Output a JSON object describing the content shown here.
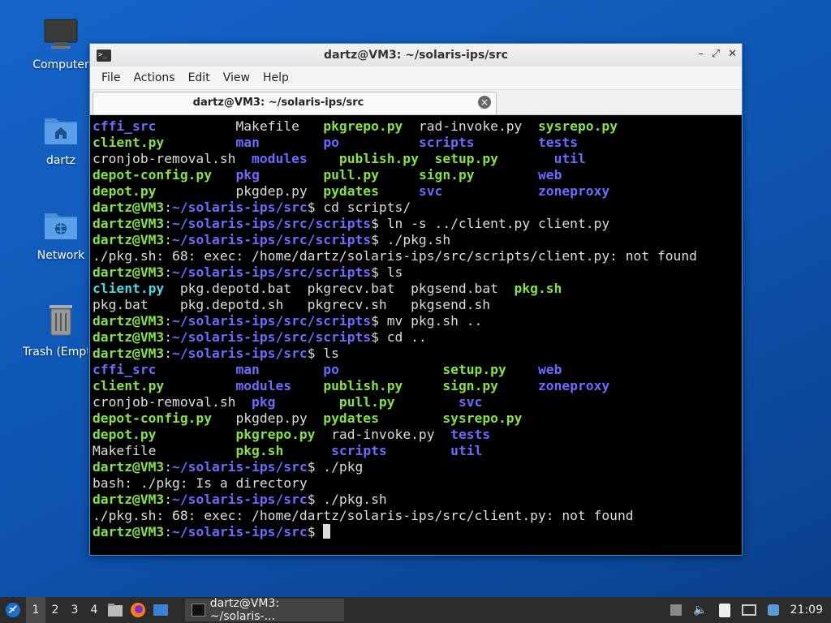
{
  "desktop": {
    "icons": [
      {
        "label": "Computer"
      },
      {
        "label": "dartz"
      },
      {
        "label": "Network"
      },
      {
        "label": "Trash (Empty)"
      }
    ]
  },
  "window": {
    "title": "dartz@VM3: ~/solaris-ips/src",
    "menu": [
      "File",
      "Actions",
      "Edit",
      "View",
      "Help"
    ],
    "tab_title": "dartz@VM3: ~/solaris-ips/src"
  },
  "terminal": {
    "colors": {
      "exec": "#86e04a",
      "dir": "#6a6bff",
      "link": "#4fd6e3",
      "text": "#dcdcdc"
    },
    "lines": [
      [
        [
          "cffi_src          ",
          "b"
        ],
        [
          "Makefile   ",
          "w"
        ],
        [
          "pkgrepo.py",
          "g"
        ],
        [
          "  ",
          "w"
        ],
        [
          "rad-invoke.py  ",
          "w"
        ],
        [
          "sysrepo.py",
          "g"
        ]
      ],
      [
        [
          "client.py",
          "g"
        ],
        [
          "         ",
          "w"
        ],
        [
          "man",
          "b"
        ],
        [
          "        ",
          "w"
        ],
        [
          "po",
          "b"
        ],
        [
          "          ",
          "w"
        ],
        [
          "scripts",
          "b"
        ],
        [
          "        ",
          "w"
        ],
        [
          "tests",
          "b"
        ]
      ],
      [
        [
          "cronjob-removal.sh  ",
          "w"
        ],
        [
          "modules",
          "b"
        ],
        [
          "    ",
          "w"
        ],
        [
          "publish.py",
          "g"
        ],
        [
          "  ",
          "w"
        ],
        [
          "setup.py",
          "g"
        ],
        [
          "       ",
          "w"
        ],
        [
          "util",
          "b"
        ]
      ],
      [
        [
          "depot-config.py",
          "g"
        ],
        [
          "   ",
          "w"
        ],
        [
          "pkg",
          "b"
        ],
        [
          "        ",
          "w"
        ],
        [
          "pull.py",
          "g"
        ],
        [
          "     ",
          "w"
        ],
        [
          "sign.py",
          "g"
        ],
        [
          "        ",
          "w"
        ],
        [
          "web",
          "b"
        ]
      ],
      [
        [
          "depot.py",
          "g"
        ],
        [
          "          ",
          "w"
        ],
        [
          "pkgdep.py  ",
          "w"
        ],
        [
          "pydates",
          "g"
        ],
        [
          "     ",
          "w"
        ],
        [
          "svc",
          "b"
        ],
        [
          "            ",
          "w"
        ],
        [
          "zoneproxy",
          "b"
        ]
      ],
      [
        [
          "dartz@VM3",
          "g"
        ],
        [
          ":",
          "w"
        ],
        [
          "~/solaris-ips/src",
          "b"
        ],
        [
          "$ cd scripts/",
          "w"
        ]
      ],
      [
        [
          "dartz@VM3",
          "g"
        ],
        [
          ":",
          "w"
        ],
        [
          "~/solaris-ips/src/scripts",
          "b"
        ],
        [
          "$ ln -s ../client.py client.py",
          "w"
        ]
      ],
      [
        [
          "dartz@VM3",
          "g"
        ],
        [
          ":",
          "w"
        ],
        [
          "~/solaris-ips/src/scripts",
          "b"
        ],
        [
          "$ ./pkg.sh",
          "w"
        ]
      ],
      [
        [
          "./pkg.sh: 68: exec: /home/dartz/solaris-ips/src/scripts/client.py: not found",
          "w"
        ]
      ],
      [
        [
          "dartz@VM3",
          "g"
        ],
        [
          ":",
          "w"
        ],
        [
          "~/solaris-ips/src/scripts",
          "b"
        ],
        [
          "$ ls",
          "w"
        ]
      ],
      [
        [
          "client.py",
          "c"
        ],
        [
          "  pkg.depotd.bat  pkgrecv.bat  pkgsend.bat  ",
          "w"
        ],
        [
          "pkg.sh",
          "g"
        ]
      ],
      [
        [
          "pkg.bat    pkg.depotd.sh   pkgrecv.sh   pkgsend.sh",
          "w"
        ]
      ],
      [
        [
          "dartz@VM3",
          "g"
        ],
        [
          ":",
          "w"
        ],
        [
          "~/solaris-ips/src/scripts",
          "b"
        ],
        [
          "$ mv pkg.sh ..",
          "w"
        ]
      ],
      [
        [
          "dartz@VM3",
          "g"
        ],
        [
          ":",
          "w"
        ],
        [
          "~/solaris-ips/src/scripts",
          "b"
        ],
        [
          "$ cd ..",
          "w"
        ]
      ],
      [
        [
          "dartz@VM3",
          "g"
        ],
        [
          ":",
          "w"
        ],
        [
          "~/solaris-ips/src",
          "b"
        ],
        [
          "$ ls",
          "w"
        ]
      ],
      [
        [
          "cffi_src",
          "b"
        ],
        [
          "          ",
          "w"
        ],
        [
          "man",
          "b"
        ],
        [
          "        ",
          "w"
        ],
        [
          "po",
          "b"
        ],
        [
          "             ",
          "w"
        ],
        [
          "setup.py",
          "g"
        ],
        [
          "    ",
          "w"
        ],
        [
          "web",
          "b"
        ]
      ],
      [
        [
          "client.py",
          "g"
        ],
        [
          "         ",
          "w"
        ],
        [
          "modules",
          "b"
        ],
        [
          "    ",
          "w"
        ],
        [
          "publish.py",
          "g"
        ],
        [
          "     ",
          "w"
        ],
        [
          "sign.py",
          "g"
        ],
        [
          "     ",
          "w"
        ],
        [
          "zoneproxy",
          "b"
        ]
      ],
      [
        [
          "cronjob-removal.sh  ",
          "w"
        ],
        [
          "pkg",
          "b"
        ],
        [
          "        ",
          "w"
        ],
        [
          "pull.py",
          "g"
        ],
        [
          "        ",
          "w"
        ],
        [
          "svc",
          "b"
        ]
      ],
      [
        [
          "depot-config.py",
          "g"
        ],
        [
          "   ",
          "w"
        ],
        [
          "pkgdep.py  ",
          "w"
        ],
        [
          "pydates",
          "g"
        ],
        [
          "        ",
          "w"
        ],
        [
          "sysrepo.py",
          "g"
        ]
      ],
      [
        [
          "depot.py",
          "g"
        ],
        [
          "          ",
          "w"
        ],
        [
          "pkgrepo.py",
          "g"
        ],
        [
          "  ",
          "w"
        ],
        [
          "rad-invoke.py  ",
          "w"
        ],
        [
          "tests",
          "b"
        ]
      ],
      [
        [
          "Makefile          ",
          "w"
        ],
        [
          "pkg.sh",
          "g"
        ],
        [
          "      ",
          "w"
        ],
        [
          "scripts",
          "b"
        ],
        [
          "        ",
          "w"
        ],
        [
          "util",
          "b"
        ]
      ],
      [
        [
          "dartz@VM3",
          "g"
        ],
        [
          ":",
          "w"
        ],
        [
          "~/solaris-ips/src",
          "b"
        ],
        [
          "$ ./pkg",
          "w"
        ]
      ],
      [
        [
          "bash: ./pkg: Is a directory",
          "w"
        ]
      ],
      [
        [
          "dartz@VM3",
          "g"
        ],
        [
          ":",
          "w"
        ],
        [
          "~/solaris-ips/src",
          "b"
        ],
        [
          "$ ./pkg.sh",
          "w"
        ]
      ],
      [
        [
          "./pkg.sh: 68: exec: /home/dartz/solaris-ips/src/client.py: not found",
          "w"
        ]
      ],
      [
        [
          "dartz@VM3",
          "g"
        ],
        [
          ":",
          "w"
        ],
        [
          "~/solaris-ips/src",
          "b"
        ],
        [
          "$ ",
          "w"
        ]
      ]
    ]
  },
  "taskbar": {
    "workspaces": [
      "1",
      "2",
      "3",
      "4"
    ],
    "task_label": "dartz@VM3: ~/solaris-...",
    "clock": "21:09"
  }
}
